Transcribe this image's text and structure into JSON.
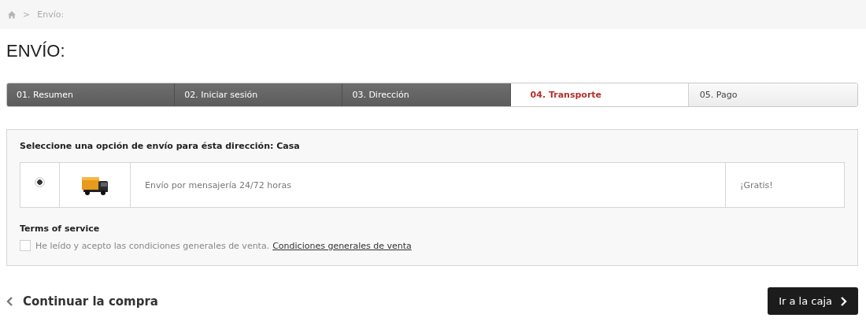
{
  "breadcrumb": {
    "separator": ">",
    "current": "Envío:"
  },
  "title": "ENVÍO:",
  "steps": [
    {
      "label": "01. Resumen",
      "done": true,
      "selected": false
    },
    {
      "label": "02. Iniciar sesión",
      "done": true,
      "selected": false
    },
    {
      "label": "03. Dirección",
      "done": true,
      "selected": false
    },
    {
      "label": "04. Transporte",
      "done": false,
      "selected": true
    },
    {
      "label": "05. Pago",
      "done": false,
      "selected": false
    }
  ],
  "delivery": {
    "heading": "Seleccione una opción de envío para ésta dirección: Casa",
    "options": [
      {
        "selected": true,
        "description": "Envío por mensajería 24/72 horas",
        "price": "¡Gratis!"
      }
    ]
  },
  "terms": {
    "heading": "Terms of service",
    "checked": false,
    "label": "He leído y acepto las condiciones generales de venta.",
    "link": "Condiciones generales de venta"
  },
  "continue_link": "Continuar la compra",
  "checkout_button": "Ir a la caja"
}
